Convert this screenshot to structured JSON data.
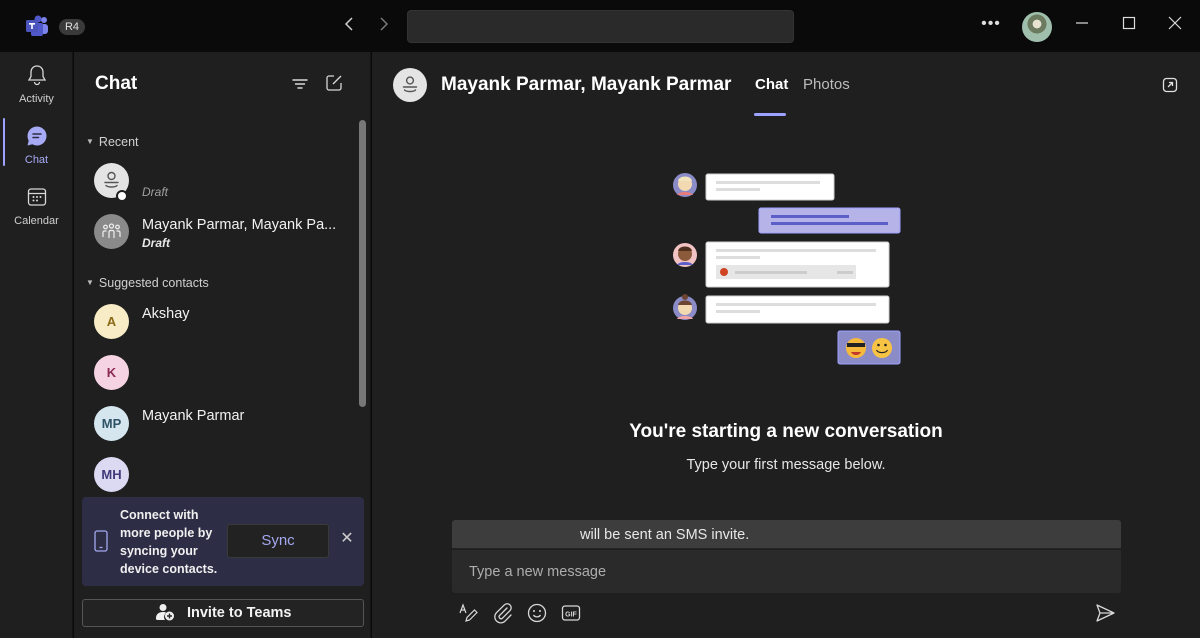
{
  "titlebar": {
    "org_badge": "R4",
    "back_icon": "chevron-left-icon",
    "forward_icon": "chevron-right-icon",
    "search_placeholder": "",
    "more_label": "•••",
    "min_glyph": "—",
    "max_glyph": "☐",
    "close_glyph": "✕"
  },
  "rail": {
    "items": [
      {
        "label": "Activity",
        "icon": "bell-icon",
        "active": false
      },
      {
        "label": "Chat",
        "icon": "chat-bubble-icon",
        "active": true
      },
      {
        "label": "Calendar",
        "icon": "calendar-icon",
        "active": false
      }
    ]
  },
  "chatlist": {
    "title": "Chat",
    "sections": [
      {
        "label": "Recent",
        "items": [
          {
            "name": "",
            "sub": "Draft",
            "avatar": "person-placeholder"
          },
          {
            "name": "Mayank Parmar, Mayank Pa...",
            "sub": "Draft",
            "avatar": "group-icon"
          }
        ]
      },
      {
        "label": "Suggested contacts",
        "items": [
          {
            "name": "Akshay",
            "initials": "A",
            "bg": "#f7ecc6",
            "fg": "#8a6a17"
          },
          {
            "name": "",
            "initials": "K",
            "bg": "#f6d3e2",
            "fg": "#8a2a55"
          },
          {
            "name": "Mayank Parmar",
            "initials": "MP",
            "bg": "#d6e6ef",
            "fg": "#2e5266"
          },
          {
            "name": "",
            "initials": "MH",
            "bg": "#dcd9f3",
            "fg": "#3e3a7a"
          }
        ]
      }
    ],
    "sync_card": {
      "text": "Connect with more people by syncing your device contacts.",
      "button": "Sync",
      "close": "✕"
    },
    "invite_button": "Invite to Teams"
  },
  "main": {
    "title": "Mayank Parmar, Mayank Parmar",
    "tabs": [
      {
        "label": "Chat",
        "active": true
      },
      {
        "label": "Photos",
        "active": false
      }
    ],
    "empty_title": "You're starting a new conversation",
    "empty_sub": "Type your first message below.",
    "sms_notice": "will be sent an SMS invite.",
    "composer_placeholder": "Type a new message",
    "composer_tools": [
      "format-icon",
      "attach-icon",
      "emoji-icon",
      "gif-icon"
    ],
    "gif_label": "GIF"
  },
  "colors": {
    "accent": "#9ea2ff",
    "sync_card_bg": "#2d2d45",
    "background": "#1f1f1f"
  }
}
